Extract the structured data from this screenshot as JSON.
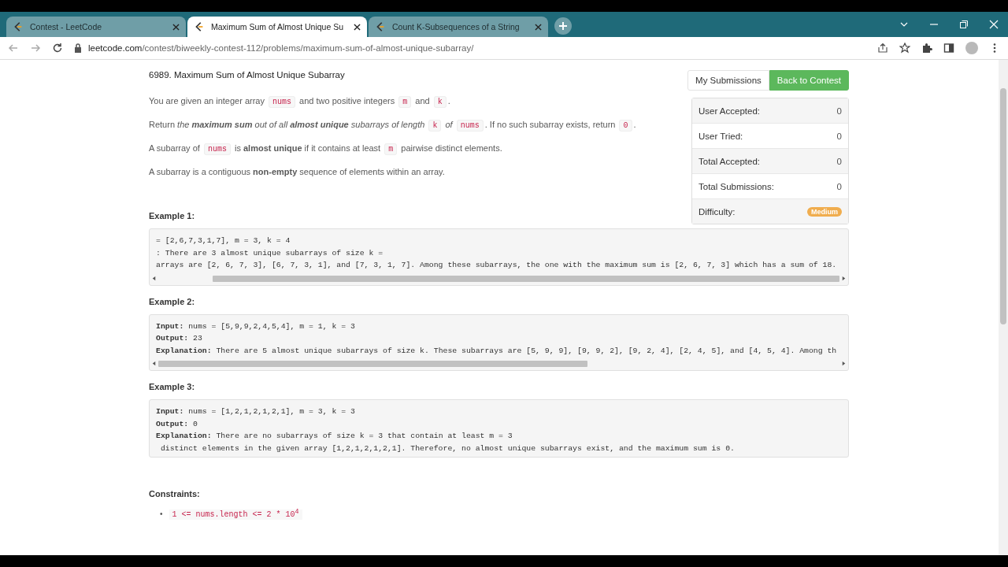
{
  "browser": {
    "tabs": [
      {
        "title": "Contest - LeetCode",
        "selected": false
      },
      {
        "title": "Maximum Sum of Almost Unique Su",
        "selected": true
      },
      {
        "title": "Count K-Subsequences of a String",
        "selected": false
      }
    ],
    "url": {
      "domain": "leetcode.com",
      "path": "/contest/biweekly-contest-112/problems/maximum-sum-of-almost-unique-subarray/"
    }
  },
  "problem": {
    "title": "6989. Maximum Sum of Almost Unique Subarray",
    "paragraphs": [
      [
        {
          "kind": "text",
          "text": "You are given an integer array "
        },
        {
          "kind": "code",
          "text": "nums"
        },
        {
          "kind": "text",
          "text": " and two positive integers "
        },
        {
          "kind": "code",
          "text": "m"
        },
        {
          "kind": "text",
          "text": " and "
        },
        {
          "kind": "code",
          "text": "k"
        },
        {
          "kind": "text",
          "text": "."
        }
      ],
      [
        {
          "kind": "text",
          "text": "Return "
        },
        {
          "kind": "italic",
          "text": "the **maximum sum** out of all **almost unique** subarrays of length "
        },
        {
          "kind": "code",
          "text": "k"
        },
        {
          "kind": "italic",
          "text": " of "
        },
        {
          "kind": "code",
          "text": "nums"
        },
        {
          "kind": "text",
          "text": ". If no such subarray exists, return "
        },
        {
          "kind": "code",
          "text": "0"
        },
        {
          "kind": "text",
          "text": "."
        }
      ],
      [
        {
          "kind": "text",
          "text": "A subarray of "
        },
        {
          "kind": "code",
          "text": "nums"
        },
        {
          "kind": "text",
          "text": " is **almost unique** if it contains at least "
        },
        {
          "kind": "code",
          "text": "m"
        },
        {
          "kind": "text",
          "text": " pairwise distinct elements."
        }
      ],
      [
        {
          "kind": "text",
          "text": "A subarray is a contiguous **non-empty** sequence of elements within an array."
        }
      ]
    ],
    "examples": [
      {
        "heading": "Example 1:",
        "scrollable": true,
        "scrolled": true,
        "lines": [
          "= [2,6,7,3,1,7], m = 3, k = 4",
          ": There are 3 almost unique subarrays of size k =",
          "arrays are [2, 6, 7, 3], [6, 7, 3, 1], and [7, 3, 1, 7]. Among these subarrays, the one with the maximum sum is [2, 6, 7, 3] which has a sum of 18."
        ]
      },
      {
        "heading": "Example 2:",
        "scrollable": true,
        "scrolled": false,
        "lines": [
          "**Input:** nums = [5,9,9,2,4,5,4], m = 1, k = 3",
          "**Output:** 23",
          "**Explanation:** There are 5 almost unique subarrays of size k. These subarrays are [5, 9, 9], [9, 9, 2], [9, 2, 4], [2, 4, 5], and [4, 5, 4]. Among th"
        ]
      },
      {
        "heading": "Example 3:",
        "scrollable": false,
        "lines": [
          "**Input:** nums = [1,2,1,2,1,2,1], m = 3, k = 3",
          "**Output:** 0",
          "**Explanation:** There are no subarrays of size k = 3 that contain at least m = 3",
          " distinct elements in the given array [1,2,1,2,1,2,1]. Therefore, no almost unique subarrays exist, and the maximum sum is 0."
        ]
      }
    ],
    "constraints": {
      "heading": "Constraints:",
      "items": [
        {
          "bullet": "•",
          "text": "1 <= nums.length <= 2 * 10$^{4}$"
        }
      ]
    }
  },
  "sidebar": {
    "buttons": [
      {
        "label": "My Submissions",
        "kind": "default"
      },
      {
        "label": "Back to Contest",
        "kind": "primary"
      }
    ],
    "stats": [
      {
        "label": "User Accepted:",
        "value": "0"
      },
      {
        "label": "User Tried:",
        "value": "0"
      },
      {
        "label": "Total Accepted:",
        "value": "0"
      },
      {
        "label": "Total Submissions:",
        "value": "0"
      },
      {
        "label": "Difficulty:",
        "badge": "Medium"
      }
    ]
  }
}
